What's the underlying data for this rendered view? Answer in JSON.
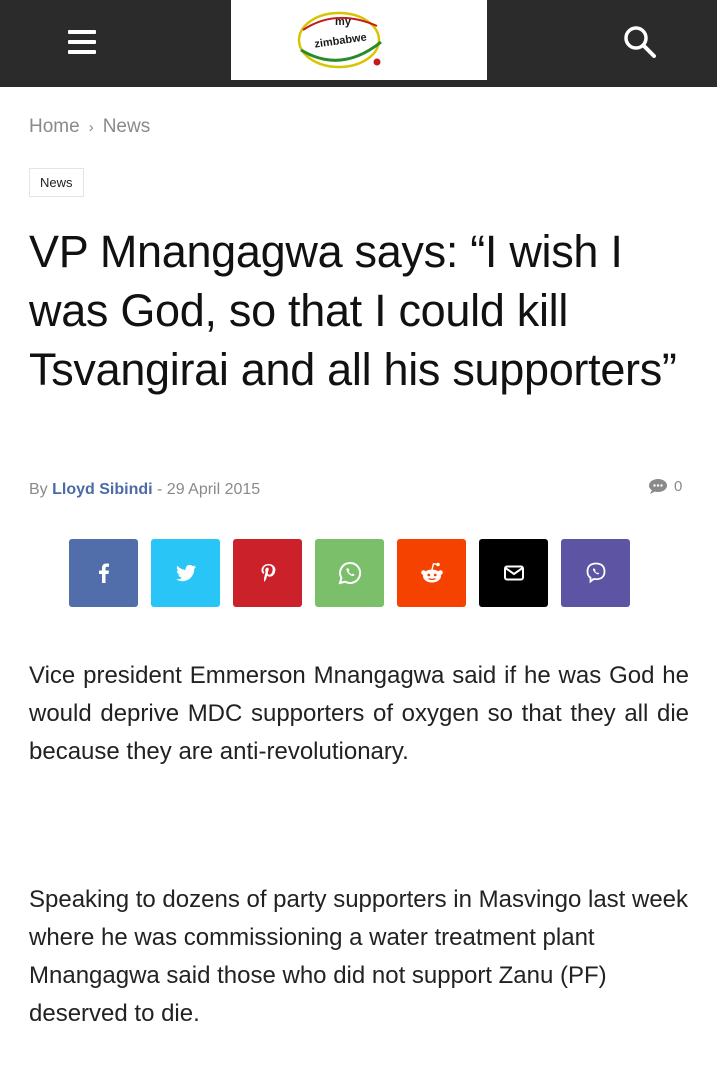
{
  "header": {
    "logo_top": "my",
    "logo_bottom": "zimbabwe",
    "menu_icon": "hamburger-menu-icon",
    "search_icon": "search-icon"
  },
  "breadcrumb": {
    "home": "Home",
    "current": "News"
  },
  "category": "News",
  "article": {
    "title": "VP Mnangagwa says: “I wish I was God, so that I could kill Tsvangirai and all his supporters”",
    "by_label": "By",
    "author": "Lloyd Sibindi",
    "dash": "-",
    "date": "29 April 2015",
    "comment_count": "0",
    "paragraphs": [
      "Vice president Emmerson Mnangagwa said if he was God he would deprive MDC supporters of oxygen so that they all die because they are anti-revolutionary.",
      "Speaking to dozens of party supporters in Masvingo last week where he was commissioning a water treatment plant Mnangagwa said those who did not support Zanu (PF) deserved to die."
    ]
  },
  "share_buttons": [
    {
      "name": "facebook",
      "icon": "facebook-icon",
      "color": "#516eab"
    },
    {
      "name": "twitter",
      "icon": "twitter-icon",
      "color": "#29c5f6"
    },
    {
      "name": "pinterest",
      "icon": "pinterest-icon",
      "color": "#ca212a"
    },
    {
      "name": "whatsapp",
      "icon": "whatsapp-icon",
      "color": "#7bbf6a"
    },
    {
      "name": "reddit",
      "icon": "reddit-icon",
      "color": "#f54200"
    },
    {
      "name": "email",
      "icon": "email-icon",
      "color": "#000000"
    },
    {
      "name": "viber",
      "icon": "viber-icon",
      "color": "#5d54a4"
    }
  ],
  "colors": {
    "header_bg": "#2b2b2b",
    "author_link": "#4b6aa8",
    "meta_gray": "#8a8a8a"
  }
}
